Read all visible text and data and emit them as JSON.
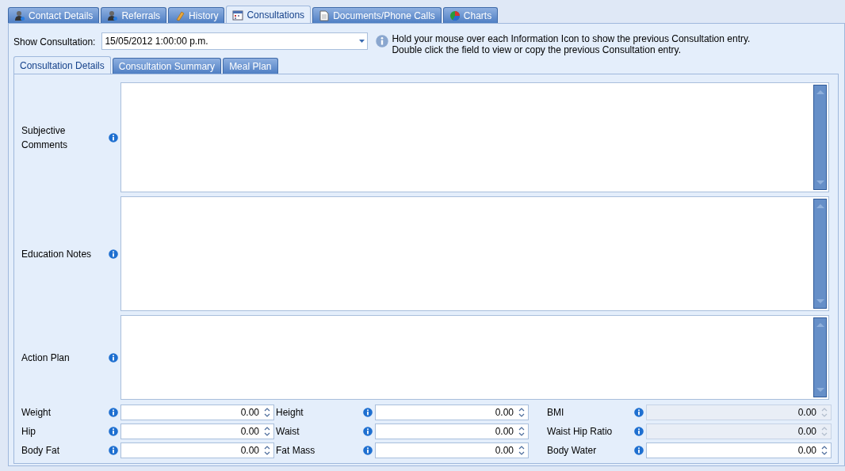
{
  "tabs": [
    {
      "label": "Contact Details",
      "selected": false
    },
    {
      "label": "Referrals",
      "selected": false
    },
    {
      "label": "History",
      "selected": false
    },
    {
      "label": "Consultations",
      "selected": true
    },
    {
      "label": "Documents/Phone Calls",
      "selected": false
    },
    {
      "label": "Charts",
      "selected": false
    }
  ],
  "show_consultation": {
    "label": "Show Consultation:",
    "value": "15/05/2012 1:00:00 p.m."
  },
  "info_lines": [
    "Hold your mouse over each Information Icon to show the previous Consultation entry.",
    "Double click the field to view or copy the previous Consultation entry."
  ],
  "subtabs": [
    {
      "label": "Consultation Details",
      "selected": true
    },
    {
      "label": "Consultation Summary",
      "selected": false
    },
    {
      "label": "Meal Plan",
      "selected": false
    }
  ],
  "text_areas": [
    {
      "label": "Subjective Comments"
    },
    {
      "label": "Education Notes"
    },
    {
      "label": "Action Plan"
    }
  ],
  "measurements": [
    [
      {
        "label": "Weight",
        "value": "0.00",
        "disabled": false
      },
      {
        "label": "Height",
        "value": "0.00",
        "disabled": false
      },
      {
        "label": "BMI",
        "value": "0.00",
        "disabled": true
      }
    ],
    [
      {
        "label": "Hip",
        "value": "0.00",
        "disabled": false
      },
      {
        "label": "Waist",
        "value": "0.00",
        "disabled": false
      },
      {
        "label": "Waist Hip Ratio",
        "value": "0.00",
        "disabled": true
      }
    ],
    [
      {
        "label": "Body Fat",
        "value": "0.00",
        "disabled": false
      },
      {
        "label": "Fat Mass",
        "value": "0.00",
        "disabled": false
      },
      {
        "label": "Body Water",
        "value": "0.00",
        "disabled": false
      }
    ]
  ]
}
